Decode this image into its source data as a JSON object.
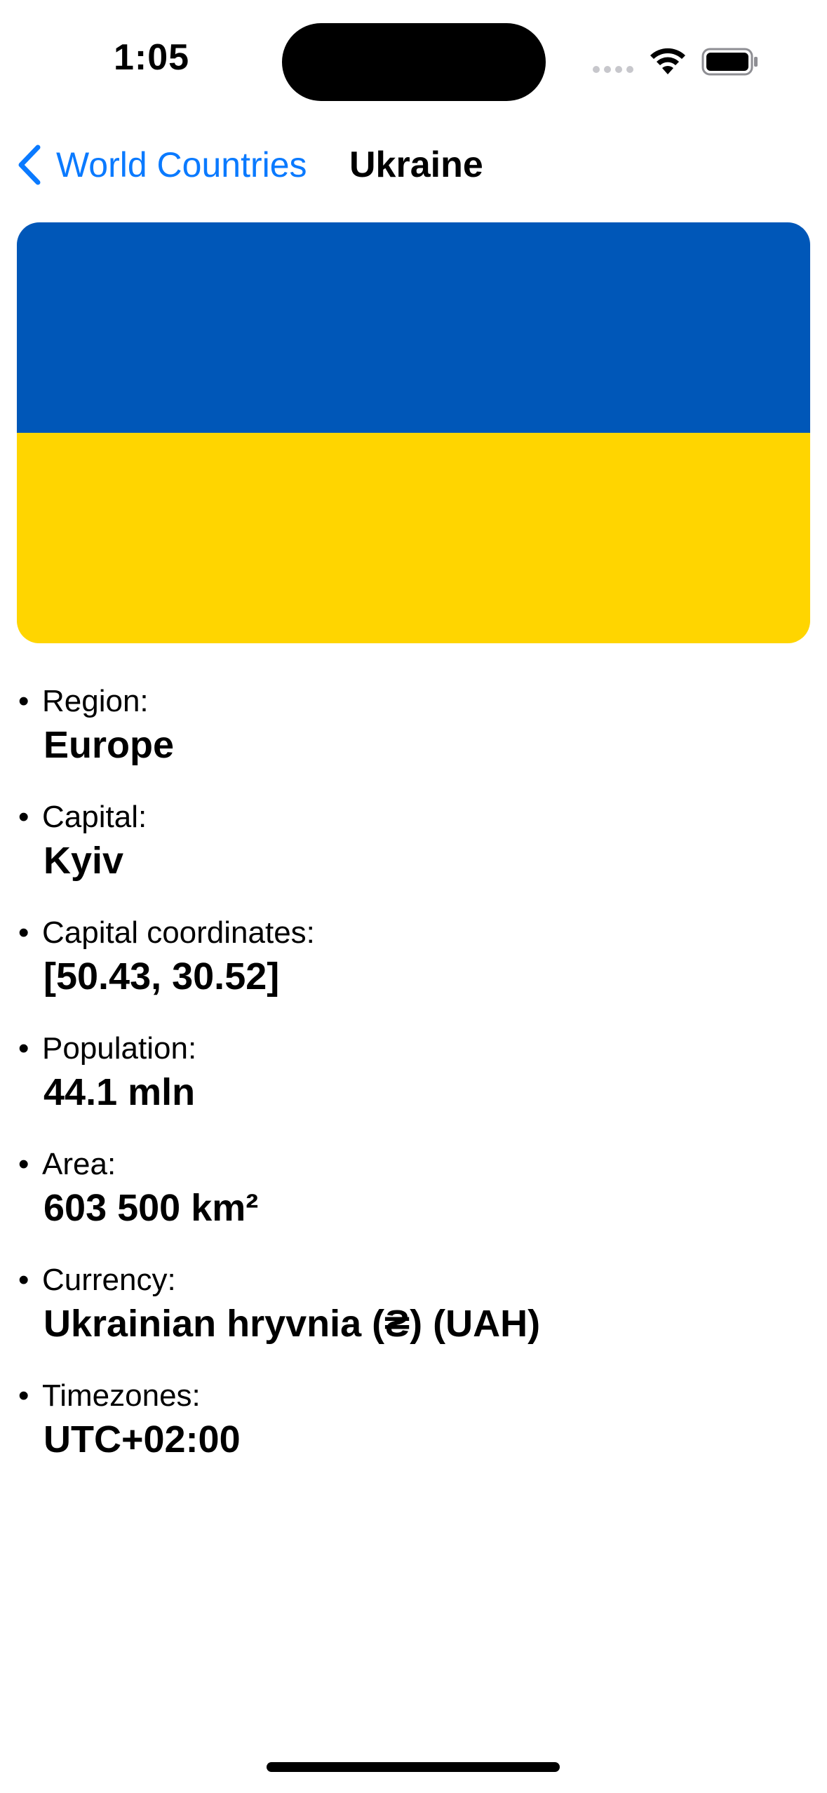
{
  "status_bar": {
    "time": "1:05"
  },
  "nav": {
    "back_label": "World Countries",
    "title": "Ukraine"
  },
  "flag": {
    "top_color": "#0057B8",
    "bottom_color": "#FFD500"
  },
  "details": [
    {
      "label": "Region:",
      "value": "Europe"
    },
    {
      "label": "Capital:",
      "value": "Kyiv"
    },
    {
      "label": "Capital coordinates:",
      "value": "[50.43, 30.52]"
    },
    {
      "label": "Population:",
      "value": "44.1 mln"
    },
    {
      "label": "Area:",
      "value": "603 500 km²"
    },
    {
      "label": "Currency:",
      "value": "Ukrainian hryvnia (₴) (UAH)"
    },
    {
      "label": "Timezones:",
      "value": "UTC+02:00"
    }
  ],
  "colors": {
    "accent": "#0A7AFF"
  }
}
